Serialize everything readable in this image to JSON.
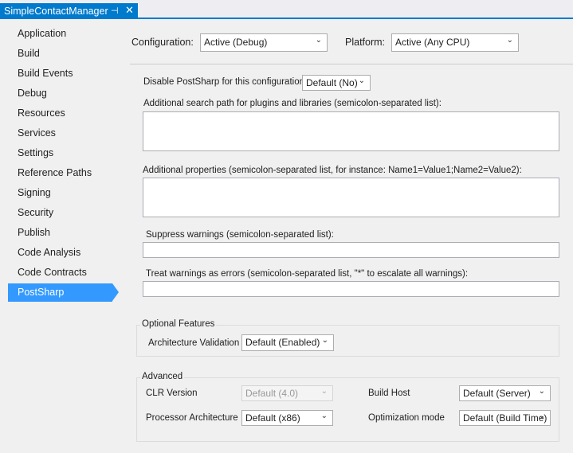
{
  "tab": {
    "title": "SimpleContactManager",
    "pin_icon": "pin-icon",
    "close_icon": "close-icon"
  },
  "colors": {
    "accent": "#007acc",
    "selected": "#3399ff"
  },
  "sidebar": {
    "items": [
      {
        "label": "Application"
      },
      {
        "label": "Build"
      },
      {
        "label": "Build Events"
      },
      {
        "label": "Debug"
      },
      {
        "label": "Resources"
      },
      {
        "label": "Services"
      },
      {
        "label": "Settings"
      },
      {
        "label": "Reference Paths"
      },
      {
        "label": "Signing"
      },
      {
        "label": "Security"
      },
      {
        "label": "Publish"
      },
      {
        "label": "Code Analysis"
      },
      {
        "label": "Code Contracts"
      },
      {
        "label": "PostSharp"
      }
    ],
    "selected": "PostSharp"
  },
  "header": {
    "configuration_label": "Configuration:",
    "configuration_value": "Active (Debug)",
    "platform_label": "Platform:",
    "platform_value": "Active (Any CPU)"
  },
  "form": {
    "disable_label": "Disable PostSharp for this configuration:",
    "disable_value": "Default (No)",
    "search_path_label": "Additional search path for plugins and libraries (semicolon-separated list):",
    "search_path_value": "",
    "properties_label": "Additional properties (semicolon-separated list, for instance: Name1=Value1;Name2=Value2):",
    "properties_value": "",
    "suppress_label": "Suppress warnings (semicolon-separated list):",
    "suppress_value": "",
    "treat_label": "Treat warnings as errors (semicolon-separated list, \"*\" to escalate all warnings):",
    "treat_value": ""
  },
  "optional": {
    "title": "Optional Features",
    "arch_validation_label": "Architecture Validation",
    "arch_validation_value": "Default (Enabled)"
  },
  "advanced": {
    "title": "Advanced",
    "clr_label": "CLR Version",
    "clr_value": "Default (4.0)",
    "build_host_label": "Build Host",
    "build_host_value": "Default (Server)",
    "proc_arch_label": "Processor Architecture",
    "proc_arch_value": "Default (x86)",
    "opt_mode_label": "Optimization mode",
    "opt_mode_value": "Default (Build Time)"
  }
}
